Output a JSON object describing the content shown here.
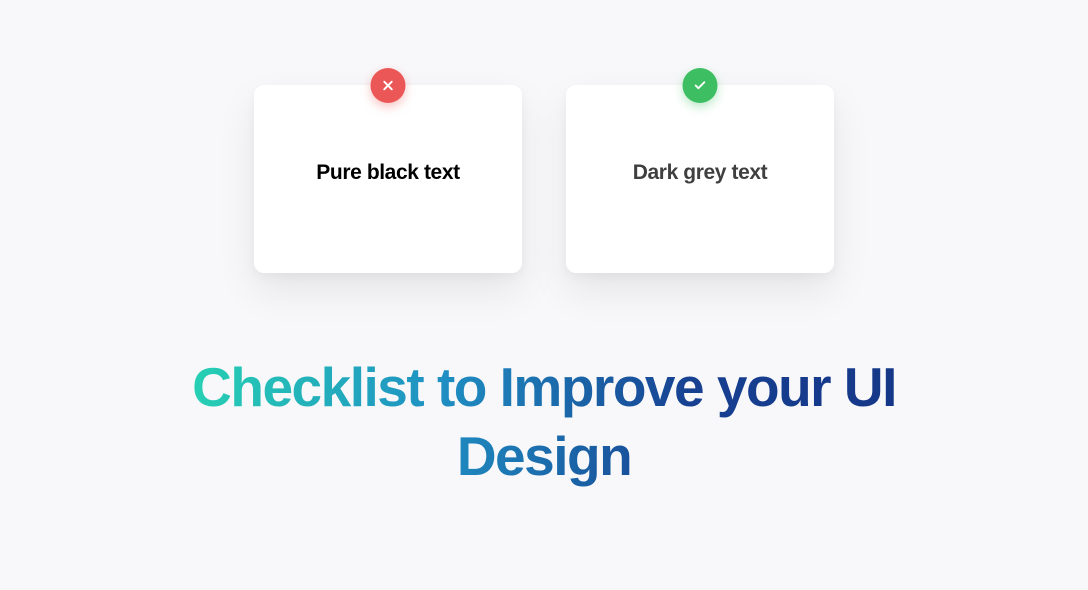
{
  "cards": {
    "bad": {
      "label": "Pure black text",
      "badge_icon": "cross-icon",
      "badge_color": "#eb5757"
    },
    "good": {
      "label": "Dark grey text",
      "badge_icon": "check-icon",
      "badge_color": "#3ebe62"
    }
  },
  "headline": "Checklist to Improve your UI Design"
}
